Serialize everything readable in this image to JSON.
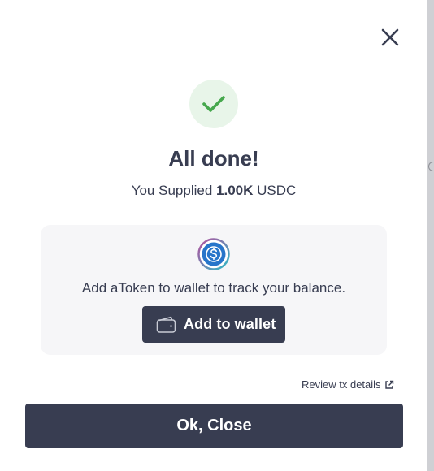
{
  "modal": {
    "title": "All done!",
    "subtitle_prefix": "You Supplied ",
    "amount": "1.00K",
    "asset": " USDC"
  },
  "card": {
    "message": "Add aToken to wallet to track your balance.",
    "add_wallet_label": "Add to wallet",
    "token_icon": "usdc-token-icon"
  },
  "links": {
    "review_label": "Review tx details"
  },
  "actions": {
    "close_label": "Ok, Close"
  },
  "icons": {
    "close": "close-icon",
    "success": "checkmark-icon",
    "wallet": "wallet-icon",
    "external": "external-link-icon"
  },
  "colors": {
    "primary": "#383d51",
    "success": "#46a84d",
    "success_bg": "#e8f5e9",
    "card_bg": "#f6f6f8",
    "usdc_blue": "#2775ca"
  }
}
